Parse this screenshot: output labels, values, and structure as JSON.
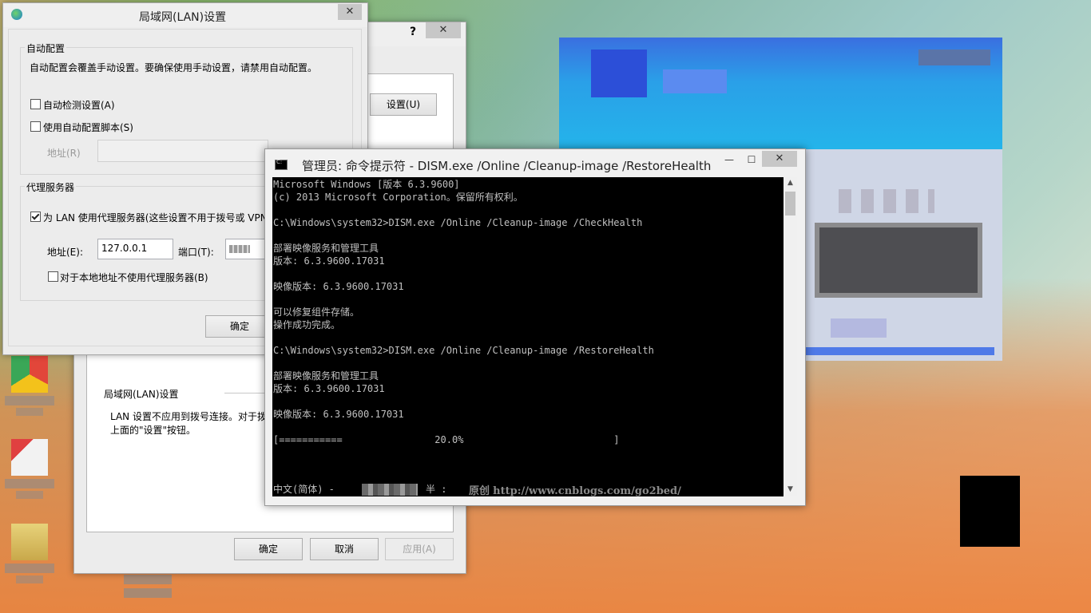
{
  "lan_dialog": {
    "title": "局域网(LAN)设置",
    "close": "✕",
    "auto_config": {
      "group_label": "自动配置",
      "description": "自动配置会覆盖手动设置。要确保使用手动设置，请禁用自动配置。",
      "auto_detect_label": "自动检测设置(A)",
      "auto_detect_checked": false,
      "use_script_label": "使用自动配置脚本(S)",
      "use_script_checked": false,
      "address_label": "地址(R)",
      "address_value": ""
    },
    "proxy": {
      "group_label": "代理服务器",
      "use_proxy_label": "为 LAN 使用代理服务器(这些设置不用于拨号或 VPN",
      "use_proxy_checked": true,
      "address_label": "地址(E):",
      "address_value": "127.0.0.1",
      "port_label": "端口(T):",
      "bypass_label": "对于本地地址不使用代理服务器(B)",
      "bypass_checked": false
    },
    "ok_label": "确定"
  },
  "internet_options": {
    "help": "?",
    "close": "✕",
    "settings_button": "设置(U)",
    "lan_section_title": "局域网(LAN)设置",
    "lan_section_text_1": "LAN 设置不应用到拨号连接。对于拨",
    "lan_section_text_2": "上面的\"设置\"按钮。",
    "ok_label": "确定",
    "cancel_label": "取消",
    "apply_label": "应用(A)"
  },
  "console": {
    "title": "管理员: 命令提示符 - DISM.exe  /Online /Cleanup-image /RestoreHealth",
    "minimize": "—",
    "maximize": "☐",
    "close": "✕",
    "lines": [
      "Microsoft Windows [版本 6.3.9600]",
      "(c) 2013 Microsoft Corporation。保留所有权利。",
      "",
      "C:\\Windows\\system32>DISM.exe /Online /Cleanup-image /CheckHealth",
      "",
      "部署映像服务和管理工具",
      "版本: 6.3.9600.17031",
      "",
      "映像版本: 6.3.9600.17031",
      "",
      "可以修复组件存储。",
      "操作成功完成。",
      "",
      "C:\\Windows\\system32>DISM.exe /Online /Cleanup-image /RestoreHealth",
      "",
      "部署映像服务和管理工具",
      "版本: 6.3.9600.17031",
      "",
      "映像版本: 6.3.9600.17031",
      "",
      "[===========                20.0%                          ]"
    ],
    "progress_percent": 20.0,
    "ime_prefix": "中文(简体) - ",
    "ime_suffix": "半 :",
    "watermark_label": "原创",
    "watermark_url": "http://www.cnblogs.com/go2bed/"
  }
}
